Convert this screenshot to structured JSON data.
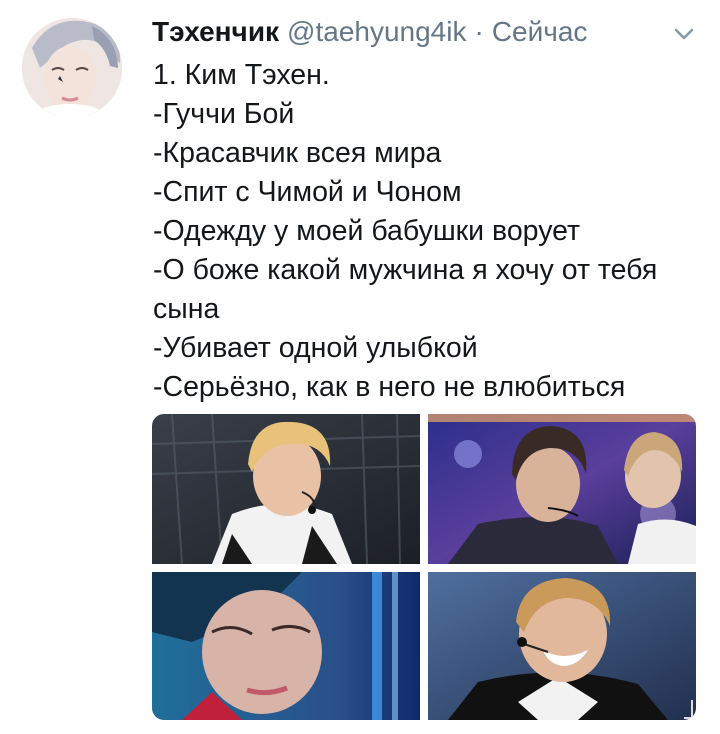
{
  "tweet": {
    "display_name": "Тэхенчик",
    "handle": "@taehyung4ik",
    "separator": "·",
    "timestamp": "Сейчас",
    "lines": [
      "1. Ким Тэхен.",
      "-Гуччи Бой",
      "-Красавчик всея мира",
      "-Спит с Чимой и Чоном",
      "-Одежду у моей бабушки ворует",
      "-О боже какой мужчина я хочу от тебя",
      "сына",
      "-Убивает одной улыбкой",
      "-Серьёзно, как в него не влюбиться"
    ],
    "media": [
      {
        "icon": "photo-concert-blond-headset"
      },
      {
        "icon": "photo-stage-blue-lights"
      },
      {
        "icon": "photo-closeup-blue-tone"
      },
      {
        "icon": "photo-smiling-headset"
      }
    ]
  },
  "colors": {
    "text": "#14171a",
    "secondary": "#657786",
    "background": "#ffffff"
  }
}
